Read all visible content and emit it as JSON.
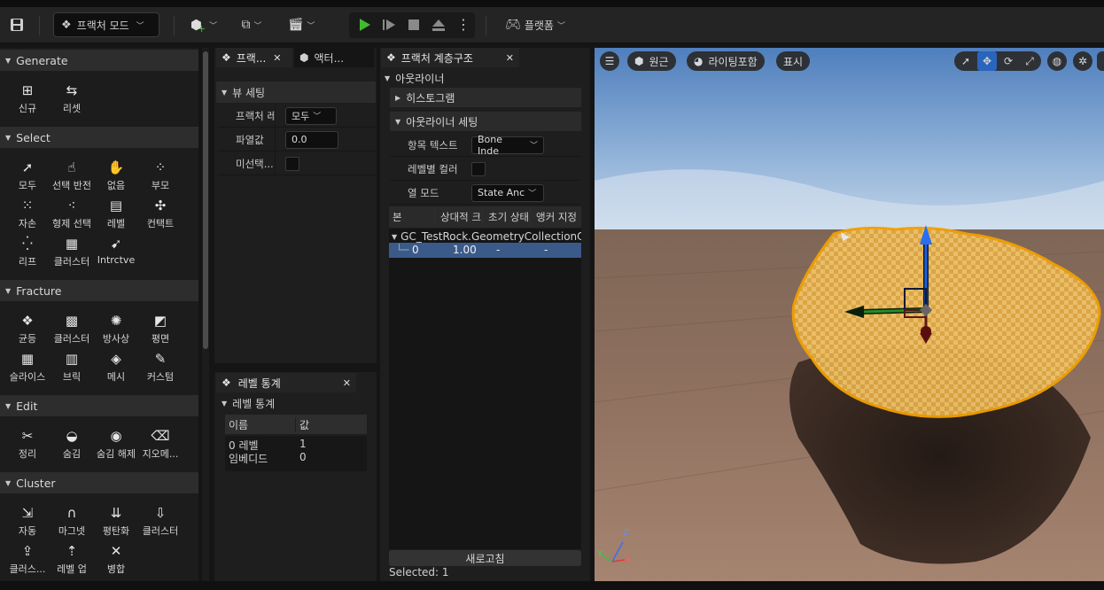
{
  "toolbar": {
    "mode_label": "프랙처 모드",
    "platform_label": "플랫폼",
    "icons": [
      "save-icon",
      "add-content-icon",
      "blueprint-icon",
      "cinematics-icon",
      "play-icon",
      "step-icon",
      "stop-icon",
      "eject-icon",
      "more-icon",
      "platform-icon"
    ]
  },
  "left": {
    "sections": [
      {
        "title": "Generate",
        "tools": [
          {
            "icon": "new-icon",
            "label": "신규"
          },
          {
            "icon": "reset-icon",
            "label": "리셋"
          }
        ]
      },
      {
        "title": "Select",
        "tools": [
          {
            "icon": "select-all-icon",
            "label": "모두"
          },
          {
            "icon": "select-invert-icon",
            "label": "선택 반전"
          },
          {
            "icon": "select-none-icon",
            "label": "없음"
          },
          {
            "icon": "select-parent-icon",
            "label": "부모"
          },
          {
            "icon": "select-children-icon",
            "label": "자손"
          },
          {
            "icon": "select-siblings-icon",
            "label": "형제 선택"
          },
          {
            "icon": "select-level-icon",
            "label": "레벨"
          },
          {
            "icon": "select-contact-icon",
            "label": "컨택트"
          },
          {
            "icon": "select-leaf-icon",
            "label": "리프"
          },
          {
            "icon": "select-cluster-icon",
            "label": "클러스터"
          },
          {
            "icon": "select-interactive-icon",
            "label": "Intrctve"
          }
        ]
      },
      {
        "title": "Fracture",
        "tools": [
          {
            "icon": "uniform-icon",
            "label": "균등"
          },
          {
            "icon": "cluster-fracture-icon",
            "label": "클러스터"
          },
          {
            "icon": "radial-icon",
            "label": "방사상"
          },
          {
            "icon": "planar-icon",
            "label": "평면"
          },
          {
            "icon": "slice-icon",
            "label": "슬라이스"
          },
          {
            "icon": "brick-icon",
            "label": "브릭"
          },
          {
            "icon": "mesh-icon",
            "label": "메시"
          },
          {
            "icon": "custom-icon",
            "label": "커스텀"
          }
        ]
      },
      {
        "title": "Edit",
        "tools": [
          {
            "icon": "tidy-icon",
            "label": "정리"
          },
          {
            "icon": "hide-icon",
            "label": "숨김"
          },
          {
            "icon": "unhide-icon",
            "label": "숨김 해제"
          },
          {
            "icon": "delete-icon",
            "label": "지오메..."
          }
        ]
      },
      {
        "title": "Cluster",
        "tools": [
          {
            "icon": "auto-cluster-icon",
            "label": "자동"
          },
          {
            "icon": "magnet-icon",
            "label": "마그넷"
          },
          {
            "icon": "flatten-icon",
            "label": "평탄화"
          },
          {
            "icon": "cluster-icon",
            "label": "클러스터"
          },
          {
            "icon": "cluster-merge-icon",
            "label": "클러스..."
          },
          {
            "icon": "level-up-icon",
            "label": "레벨 업"
          },
          {
            "icon": "merge-icon",
            "label": "병합"
          }
        ]
      }
    ]
  },
  "mid": {
    "tabs": [
      "프랙...",
      "액터..."
    ],
    "view_settings_title": "뷰 세팅",
    "rows": [
      {
        "label": "프랙처 레",
        "value": "모두"
      },
      {
        "label": "파열값",
        "value": "0.0"
      },
      {
        "label": "미선택...",
        "value": ""
      }
    ]
  },
  "stats": {
    "tab": "레벨 통계",
    "section": "레벨 통계",
    "columns": [
      "이름",
      "값"
    ],
    "rows": [
      [
        "0 레벨",
        "1"
      ],
      [
        "임베디드",
        "0"
      ]
    ]
  },
  "outliner": {
    "tab": "프랙처 계층구조",
    "section": "아웃라이너",
    "histogram": "히스토그램",
    "settings_title": "아웃라이너 세팅",
    "settings": [
      {
        "label": "항목 텍스트",
        "value": "Bone Inde"
      },
      {
        "label": "레벨별 컬러",
        "value": ""
      },
      {
        "label": "열 모드",
        "value": "State Anc"
      }
    ],
    "columns": [
      "본",
      "상대적 크",
      "초기 상태",
      "앵커 지정"
    ],
    "root": "GC_TestRock.GeometryCollectionC",
    "row": [
      "0",
      "1.00",
      "-",
      "-"
    ],
    "refresh": "새로고침",
    "selected": "Selected: 1"
  },
  "viewport": {
    "perspective": "원근",
    "lighting": "라이팅포함",
    "show": "표시",
    "axis_labels": [
      "Z",
      "Y",
      "X"
    ]
  }
}
